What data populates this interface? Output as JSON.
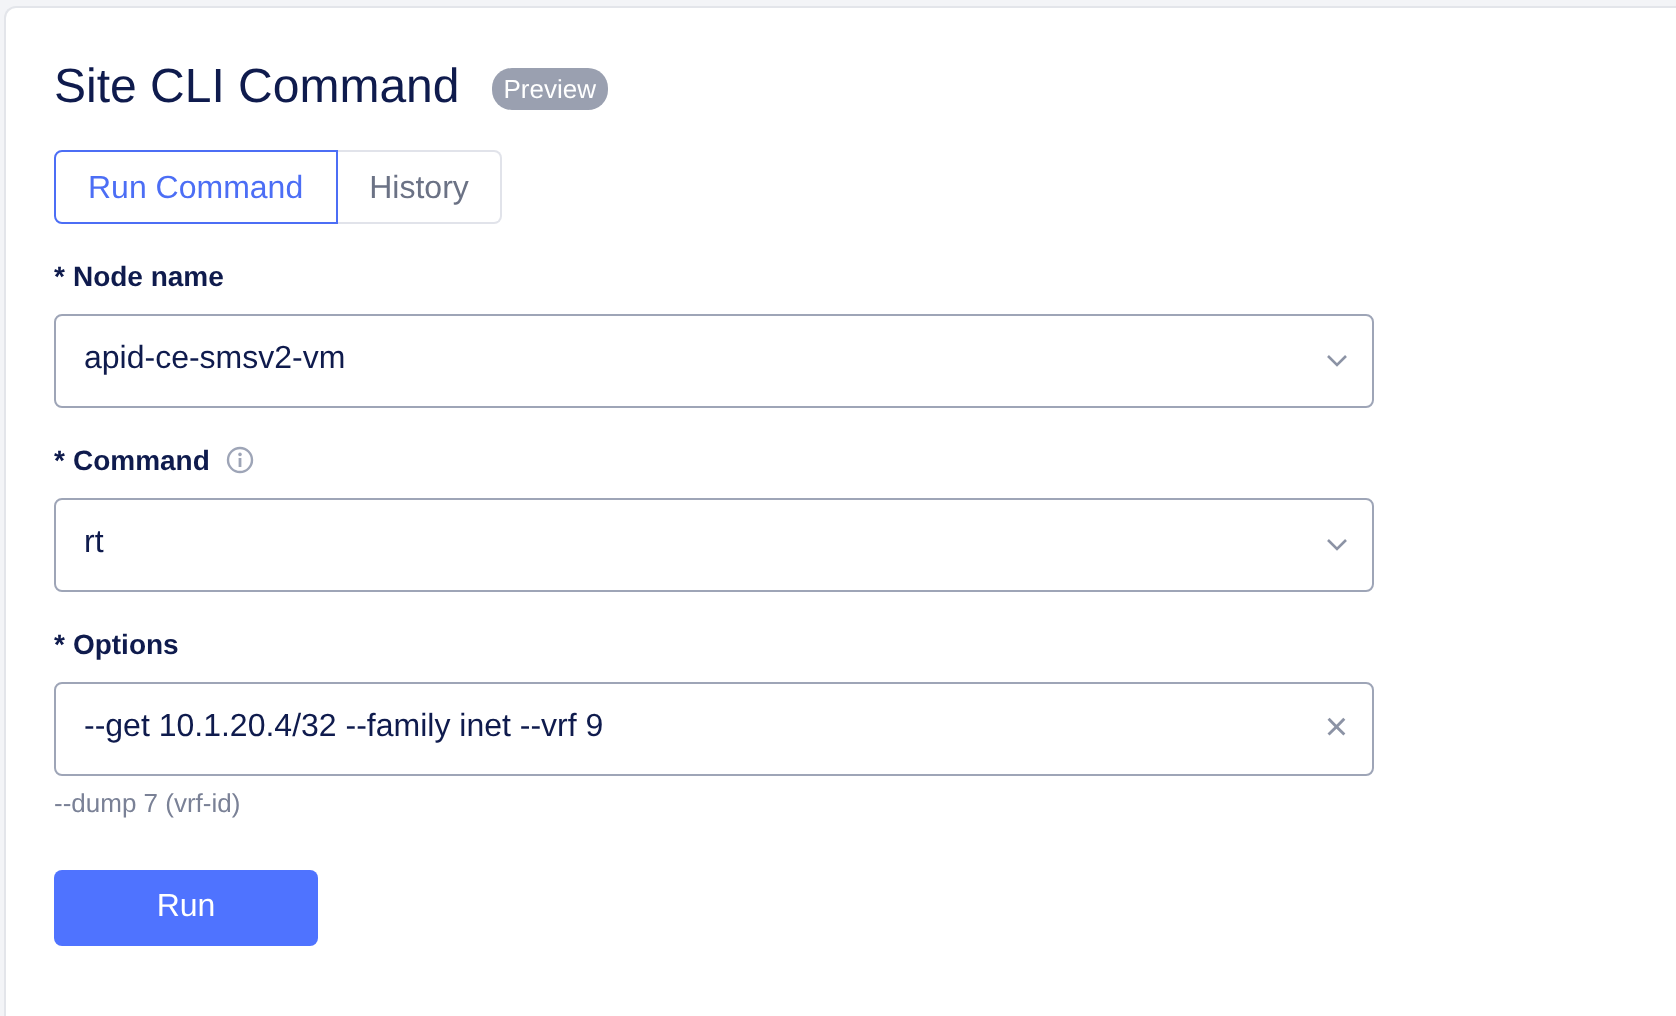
{
  "title": "Site CLI Command",
  "badge": "Preview",
  "tabs": [
    {
      "label": "Run Command",
      "selected": true
    },
    {
      "label": "History",
      "selected": false
    }
  ],
  "fields": [
    {
      "label": "Node name",
      "required": true,
      "kind": "select",
      "value": "apid-ce-smsv2-vm",
      "info": false
    },
    {
      "label": "Command",
      "required": true,
      "kind": "select",
      "value": "rt",
      "info": true
    },
    {
      "label": "Options",
      "required": true,
      "kind": "text",
      "value": "--get 10.1.20.4/32 --family inet --vrf 9",
      "info": false,
      "help": "--dump 7 (vrf-id)"
    }
  ],
  "required_mark": "*",
  "clear_glyph": "×",
  "submit": "Run"
}
